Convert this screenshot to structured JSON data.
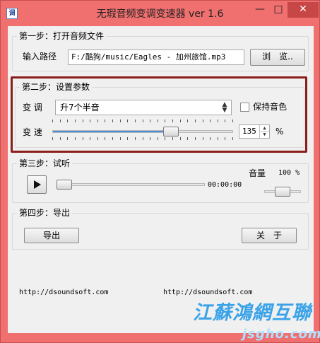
{
  "window": {
    "title": "无瑕音频变调变速器 ver 1.6",
    "icon_text": "调",
    "min_glyph": "—",
    "max_glyph": "□",
    "close_glyph": "✕"
  },
  "step1": {
    "title": "第一步：打开音频文件",
    "path_label": "输入路径",
    "path_value": "F:/酷狗/music/Eagles - 加州旅馆.mp3",
    "browse_label": "浏　览.."
  },
  "step2": {
    "title": "第二步：设置参数",
    "pitch_label": "变 调",
    "pitch_value": "升7个半音",
    "keep_tone_label": "保持音色",
    "keep_tone_checked": false,
    "speed_label": "变 速",
    "speed_value": "135",
    "speed_unit": "%",
    "speed_fraction": 0.67
  },
  "step3": {
    "title": "第三步：试听",
    "time": "00:00:00",
    "volume_label": "音量",
    "volume_value": "100 %",
    "volume_fraction": 0.5,
    "progress_fraction": 0.0
  },
  "step4": {
    "title": "第四步：导出",
    "export_label": "导出",
    "close_label": "关　于"
  },
  "footer": {
    "url_left": "http://dsoundsoft.com",
    "url_right": "http://dsoundsoft.com"
  },
  "watermark": {
    "main": "江蘇鴻網互聯",
    "sub": "jsgho.com"
  },
  "colors": {
    "titlebar": "#f06f6f",
    "highlight": "#8b1d1d",
    "slider_fill": "#4a8fd8"
  }
}
